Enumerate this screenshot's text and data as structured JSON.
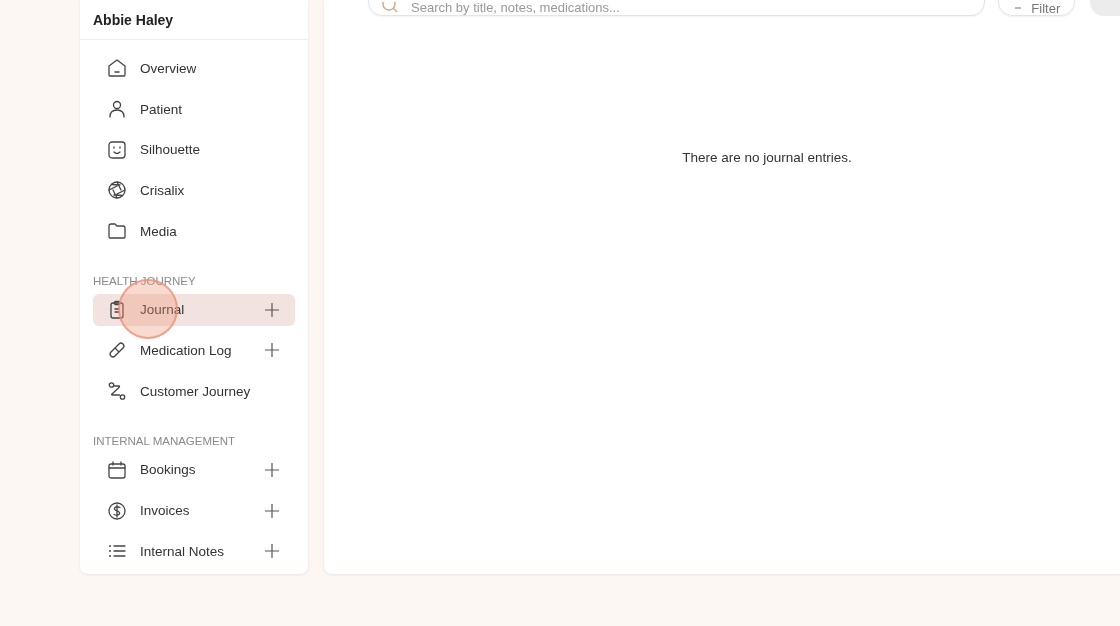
{
  "sidebar": {
    "title": "Abbie Haley",
    "sections": [
      {
        "items": [
          {
            "label": "Overview",
            "selected": false,
            "has_add": false
          },
          {
            "label": "Patient",
            "selected": false,
            "has_add": false
          },
          {
            "label": "Silhouette",
            "selected": false,
            "has_add": false
          },
          {
            "label": "Crisalix",
            "selected": false,
            "has_add": false
          },
          {
            "label": "Media",
            "selected": false,
            "has_add": false
          }
        ]
      },
      {
        "heading": "HEALTH JOURNEY",
        "items": [
          {
            "label": "Journal",
            "selected": true,
            "has_add": true
          },
          {
            "label": "Medication Log",
            "selected": false,
            "has_add": true
          },
          {
            "label": "Customer Journey",
            "selected": false,
            "has_add": false
          }
        ]
      },
      {
        "heading": "INTERNAL MANAGEMENT",
        "items": [
          {
            "label": "Bookings",
            "selected": false,
            "has_add": true
          },
          {
            "label": "Invoices",
            "selected": false,
            "has_add": true
          },
          {
            "label": "Internal Notes",
            "selected": false,
            "has_add": true
          }
        ]
      }
    ]
  },
  "toolbar": {
    "search": {
      "placeholder": "Search by title, notes, medications..."
    },
    "filter_button": "Filter"
  },
  "empty_message": "There are no journal entries.",
  "cursor_ring": true
}
